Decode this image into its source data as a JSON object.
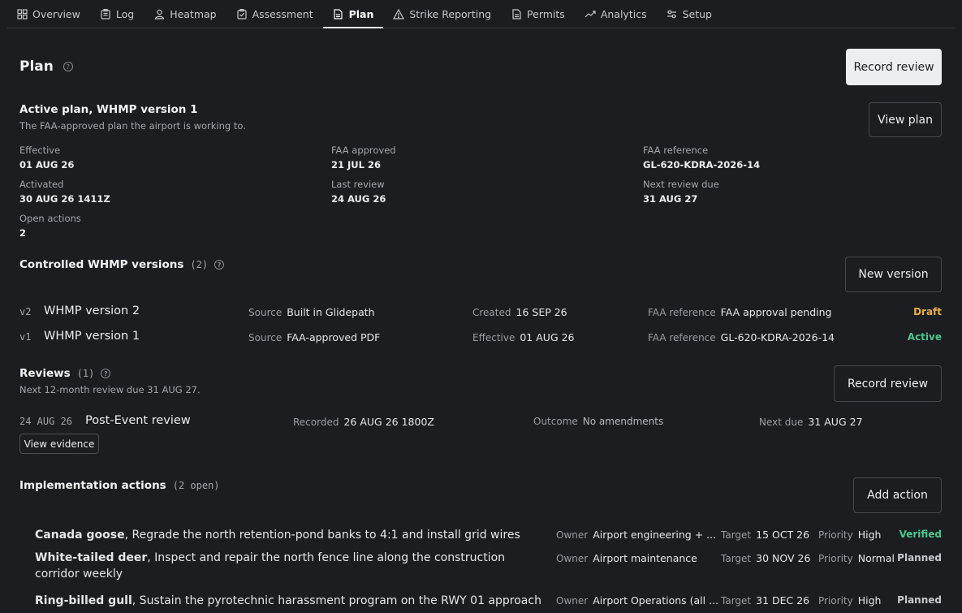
{
  "nav": {
    "tabs": [
      {
        "label": "Overview",
        "icon": "grid-icon"
      },
      {
        "label": "Log",
        "icon": "clipboard-icon"
      },
      {
        "label": "Heatmap",
        "icon": "person-icon"
      },
      {
        "label": "Assessment",
        "icon": "clipboard-check-icon"
      },
      {
        "label": "Plan",
        "icon": "document-icon",
        "active": true
      },
      {
        "label": "Strike Reporting",
        "icon": "warning-icon"
      },
      {
        "label": "Permits",
        "icon": "document-icon"
      },
      {
        "label": "Analytics",
        "icon": "trend-icon"
      },
      {
        "label": "Setup",
        "icon": "sliders-icon"
      }
    ]
  },
  "page": {
    "title": "Plan",
    "help_glyph": "?",
    "record_review_primary": "Record review"
  },
  "active_plan": {
    "title": "Active plan, WHMP version 1",
    "subtitle": "The FAA-approved plan the airport is working to.",
    "view_plan_label": "View plan",
    "fields": [
      {
        "label": "Effective",
        "value": "01 AUG 26"
      },
      {
        "label": "FAA approved",
        "value": "21 JUL 26"
      },
      {
        "label": "FAA reference",
        "value": "GL-620-KDRA-2026-14"
      },
      {
        "label": "Activated",
        "value": "30 AUG 26 1411Z"
      },
      {
        "label": "Last review",
        "value": "24 AUG 26"
      },
      {
        "label": "Next review due",
        "value": "31 AUG 27"
      },
      {
        "label": "Open actions",
        "value": "2"
      }
    ]
  },
  "versions": {
    "title": "Controlled WHMP versions",
    "count": "(2)",
    "new_version_label": "New version",
    "rows": [
      {
        "code": "v2",
        "name": "WHMP version 2",
        "source_label": "Source",
        "source": "Built in Glidepath",
        "date_label": "Created",
        "date": "16 SEP 26",
        "ref_label": "FAA reference",
        "ref": "FAA approval pending",
        "status": "Draft"
      },
      {
        "code": "v1",
        "name": "WHMP version 1",
        "source_label": "Source",
        "source": "FAA-approved PDF",
        "date_label": "Effective",
        "date": "01 AUG 26",
        "ref_label": "FAA reference",
        "ref": "GL-620-KDRA-2026-14",
        "status": "Active"
      }
    ]
  },
  "reviews": {
    "title": "Reviews",
    "count": "(1)",
    "subtitle": "Next 12-month review due 31 AUG 27.",
    "record_review_label": "Record review",
    "rows": [
      {
        "date": "24 AUG 26",
        "name": "Post-Event review",
        "recorded_label": "Recorded",
        "recorded": "26 AUG 26 1800Z",
        "outcome_label": "Outcome",
        "outcome": "No amendments",
        "next_label": "Next due",
        "next": "31 AUG 27",
        "evidence_label": "View evidence"
      }
    ]
  },
  "actions": {
    "title": "Implementation actions",
    "count": "(2 open)",
    "add_label": "Add action",
    "rows": [
      {
        "species": "Canada goose",
        "text": ", Regrade the north retention-pond banks to 4:1 and install grid wires",
        "owner_label": "Owner",
        "owner": "Airport engineering + ...",
        "target_label": "Target",
        "target": "15 OCT 26",
        "priority_label": "Priority",
        "priority": "High",
        "status": "Verified"
      },
      {
        "species": "White-tailed deer",
        "text": ", Inspect and repair the north fence line along the construction corridor weekly",
        "owner_label": "Owner",
        "owner": "Airport maintenance",
        "target_label": "Target",
        "target": "30 NOV 26",
        "priority_label": "Priority",
        "priority": "Normal",
        "status": "Planned"
      },
      {
        "species": "Ring-billed gull",
        "text": ", Sustain the pyrotechnic harassment program on the RWY 01 approach",
        "owner_label": "Owner",
        "owner": "Airport Operations (all ...",
        "target_label": "Target",
        "target": "31 DEC 26",
        "priority_label": "Priority",
        "priority": "High",
        "status": "Planned"
      }
    ]
  },
  "colors": {
    "background": "#1c1d20",
    "draft": "#e8b04b",
    "active": "#4cc68c"
  }
}
